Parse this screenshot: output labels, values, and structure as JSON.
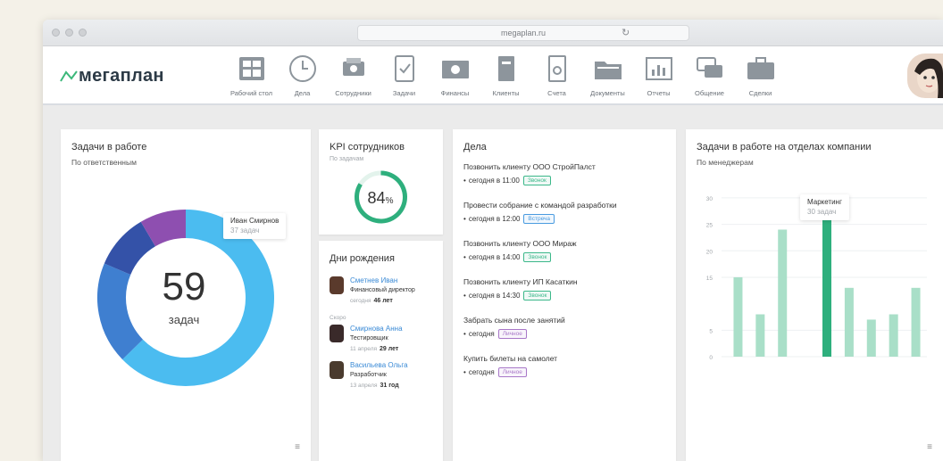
{
  "browser": {
    "url": "megaplan.ru"
  },
  "app": {
    "logo": "мегаплан",
    "nav": [
      {
        "label": "Рабочий стол",
        "icon": "dashboard-icon"
      },
      {
        "label": "Дела",
        "icon": "clock-icon"
      },
      {
        "label": "Сотрудники",
        "icon": "employees-icon"
      },
      {
        "label": "Задачи",
        "icon": "tasks-icon"
      },
      {
        "label": "Финансы",
        "icon": "finance-icon"
      },
      {
        "label": "Клиенты",
        "icon": "clients-icon"
      },
      {
        "label": "Счета",
        "icon": "invoices-icon"
      },
      {
        "label": "Документы",
        "icon": "documents-icon"
      },
      {
        "label": "Отчеты",
        "icon": "reports-icon"
      },
      {
        "label": "Общение",
        "icon": "chat-icon"
      },
      {
        "label": "Сделки",
        "icon": "deals-icon"
      }
    ]
  },
  "tasks_card": {
    "title": "Задачи в работе",
    "subtitle": "По ответственным",
    "total": "59",
    "total_label": "задач",
    "tooltip_name": "Иван Смирнов",
    "tooltip_value": "37 задач"
  },
  "kpi_card": {
    "title": "KPI сотрудников",
    "subtitle": "По задачам",
    "value": "84",
    "unit": "%"
  },
  "birthdays": {
    "title": "Дни рождения",
    "soon_label": "Скоро",
    "people": [
      {
        "name": "Сметнев Иван",
        "position": "Финансовый директор",
        "date": "сегодня",
        "age": "46 лет"
      },
      {
        "name": "Смирнова Анна",
        "position": "Тестировщик",
        "date": "11 апреля",
        "age": "29 лет"
      },
      {
        "name": "Васильева Ольга",
        "position": "Разработчик",
        "date": "13 апреля",
        "age": "31 год"
      }
    ]
  },
  "deals_card": {
    "title": "Дела",
    "items": [
      {
        "title": "Позвонить клиенту ООО СтройПалст",
        "when": "сегодня в 11:00",
        "tag": "Звонок",
        "tag_color": "#3cb88a"
      },
      {
        "title": "Провести собрание с командой разработки",
        "when": "сегодня в 12:00",
        "tag": "Встреча",
        "tag_color": "#4a9be0"
      },
      {
        "title": "Позвонить клиенту ООО Мираж",
        "when": "сегодня в 14:00",
        "tag": "Звонок",
        "tag_color": "#3cb88a"
      },
      {
        "title": "Позвонить клиенту ИП Касаткин",
        "when": "сегодня в 14:30",
        "tag": "Звонок",
        "tag_color": "#3cb88a"
      },
      {
        "title": "Забрать сына после занятий",
        "when": "сегодня",
        "tag": "Личное",
        "tag_color": "#a877c8"
      },
      {
        "title": "Купить билеты на самолет",
        "when": "сегодня",
        "tag": "Личное",
        "tag_color": "#a877c8"
      }
    ]
  },
  "dept_card": {
    "title": "Задачи в работе на отделах компании",
    "subtitle": "По менеджерам",
    "tooltip_name": "Маркетинг",
    "tooltip_value": "30 задач"
  },
  "colors": {
    "accent_green": "#2eaf7d",
    "light_green": "#a9dfc8",
    "donut": [
      "#4bbcf0",
      "#3f7fd0",
      "#3452a8",
      "#8e4fb0"
    ]
  },
  "chart_data": [
    {
      "type": "pie",
      "title": "Задачи в работе",
      "subtitle": "По ответственным",
      "categories": [
        "Иван Смирнов",
        "",
        "",
        ""
      ],
      "values": [
        37,
        11,
        6,
        5
      ],
      "total": 59
    },
    {
      "type": "bar",
      "title": "Задачи в работе на отделах компании",
      "subtitle": "По менеджерам",
      "categories": [
        "",
        "",
        "",
        "",
        "",
        "",
        "",
        "",
        ""
      ],
      "values": [
        15,
        8,
        24,
        0,
        30,
        13,
        7,
        8,
        13
      ],
      "highlight_index": 4,
      "highlight_label": "Маркетинг",
      "yticks": [
        0,
        5,
        15,
        20,
        25,
        30
      ],
      "ylim": [
        0,
        32
      ]
    }
  ]
}
